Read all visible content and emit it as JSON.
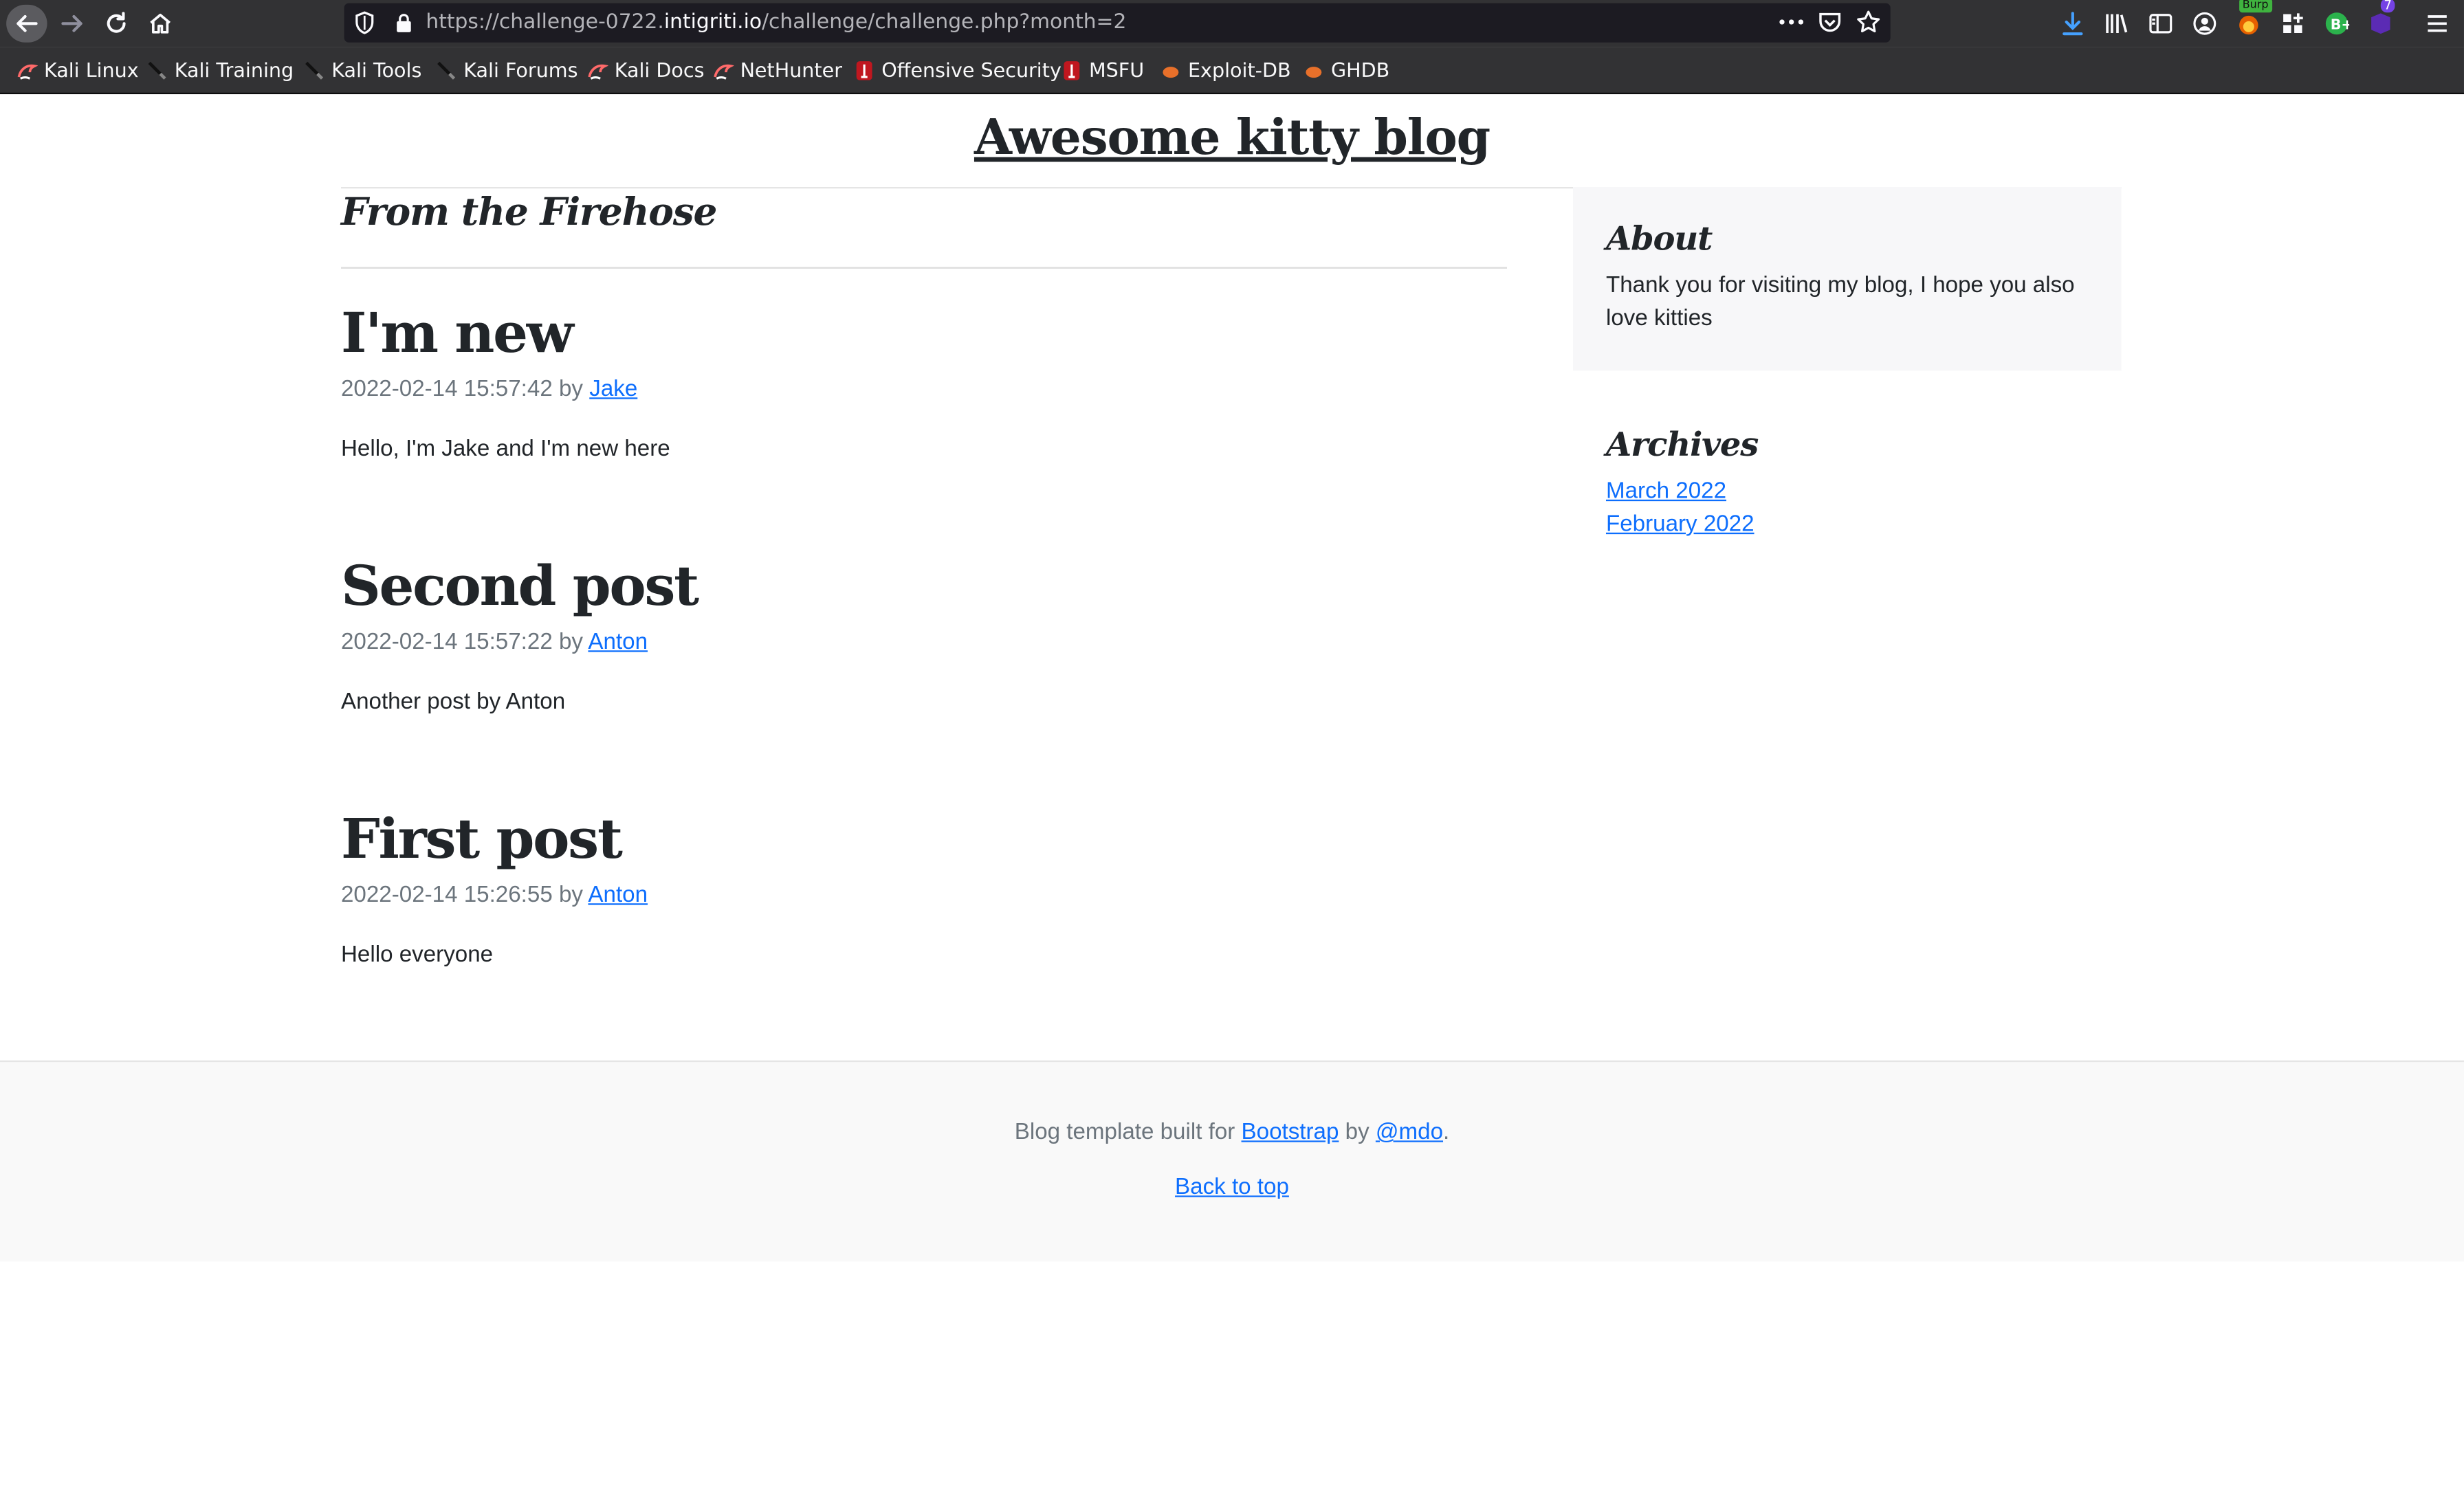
{
  "browser": {
    "url_prefix": "https://challenge-0722.",
    "url_domain": "intigriti.io",
    "url_path": "/challenge/challenge.php?month=2",
    "bookmarks": [
      "Kali Linux",
      "Kali Training",
      "Kali Tools",
      "Kali Forums",
      "Kali Docs",
      "NetHunter",
      "Offensive Security",
      "MSFU",
      "Exploit-DB",
      "GHDB"
    ],
    "burp_badge": "Burp",
    "ext_count": "7"
  },
  "site": {
    "title": "Awesome kitty blog",
    "section_heading": "From the Firehose"
  },
  "posts": [
    {
      "title": "I'm new",
      "date": "2022-02-14 15:57:42",
      "by": "by",
      "author": "Jake",
      "body": "Hello, I'm Jake and I'm new here"
    },
    {
      "title": "Second post",
      "date": "2022-02-14 15:57:22",
      "by": "by",
      "author": "Anton",
      "body": "Another post by Anton"
    },
    {
      "title": "First post",
      "date": "2022-02-14 15:26:55",
      "by": "by",
      "author": "Anton",
      "body": "Hello everyone"
    }
  ],
  "sidebar": {
    "about_heading": "About",
    "about_text": "Thank you for visiting my blog, I hope you also love kitties",
    "archives_heading": "Archives",
    "archives": [
      "March 2022",
      "February 2022"
    ]
  },
  "footer": {
    "text_before": "Blog template built for",
    "bootstrap_link": "Bootstrap",
    "text_mid": "by",
    "mdo_link": "@mdo",
    "text_end": ".",
    "back_to_top": "Back to top"
  },
  "colors": {
    "link": "#0d6efd",
    "chrome": "#323234",
    "urlbar": "#1c1b22"
  }
}
